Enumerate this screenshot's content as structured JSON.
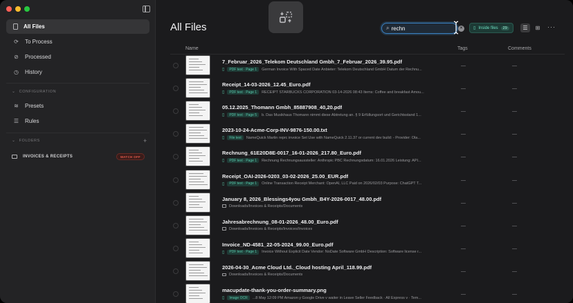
{
  "sidebar": {
    "nav": [
      {
        "label": "All Files",
        "icon": "document-icon",
        "active": true
      },
      {
        "label": "To Process",
        "icon": "refresh-icon"
      },
      {
        "label": "Processed",
        "icon": "check-circle-icon"
      },
      {
        "label": "History",
        "icon": "clock-icon"
      }
    ],
    "configuration_label": "CONFIGURATION",
    "config_items": [
      {
        "label": "Presets",
        "icon": "stack-icon"
      },
      {
        "label": "Rules",
        "icon": "list-icon"
      }
    ],
    "folders_label": "FOLDERS",
    "folder": {
      "name": "INVOICES & RECEIPTS",
      "badge": "WATCH OFF"
    }
  },
  "header": {
    "title": "All Files",
    "search_value": "rechn",
    "inside_files_label": "Inside files",
    "inside_files_count": "29"
  },
  "columns": {
    "name": "Name",
    "tags": "Tags",
    "comments": "Comments"
  },
  "files": [
    {
      "name": "7_Februar_2026_Telekom Deutschland Gmbh_7_Februar_2026_39.95.pdf",
      "badge": "PDF text · Page 1",
      "snippet": "German Invoice With Spaced Date Anbieter: Telekom Deutschland GmbH Datum der Rechnu...",
      "tags": "—",
      "comments": "—"
    },
    {
      "name": "Receipt_14-03-2026_12.45_Euro.pdf",
      "badge": "PDF text · Page 1",
      "snippet": "RECEIPT STARBUCKS CORPORATION 03-14-2026 08:43 Items: Coffee and breakfast Amou...",
      "tags": "—",
      "comments": "—"
    },
    {
      "name": "05.12.2025_Thomann Gmbh_85887908_40,20.pdf",
      "badge": "PDF text · Page 5",
      "snippet": "b. Das Musikhaus Thomann nimmt diese Abtretung an. § 9 Erfüllungsort und Gerichtsstand 1...",
      "tags": "—",
      "comments": "—"
    },
    {
      "name": "2023-10-24-Acme-Corp-INV-9876-150.00.txt",
      "badge": "File text",
      "snippet": "NameQuick Martin reprc invoice Set Use with NameQuick 2.11.37 or current dev build: - Provider: Ola...",
      "tags": "—",
      "comments": "—"
    },
    {
      "name": "Rechnung_61E20D8E-0017_16-01-2026_217.80_Euro.pdf",
      "badge": "PDF text · Page 1",
      "snippet": "Rechnung Rechnungsaussteller: Anthropic PBC Rechnungsdatum: 16.01.2026 Leistung: API...",
      "tags": "—",
      "comments": "—"
    },
    {
      "name": "Receipt_OAI-2026-0203_03-02-2026_25.00_EUR.pdf",
      "badge": "PDF text · Page 1",
      "snippet": "Online Transaction Receipt Merchant: OpenAI, LLC Paid on 2026/02/03 Purpose: ChatGPT T...",
      "tags": "—",
      "comments": "—"
    },
    {
      "name": "January 8, 2026_Blessings4you Gmbh_B4Y-2026-0017_48.00.pdf",
      "path": "Downloads/Invoices & Receipts/Documents",
      "tags": "—",
      "comments": "—"
    },
    {
      "name": "Jahresabrechnung_08-01-2026_48.00_Euro.pdf",
      "path": "Downloads/Invoices & Receipts/Invoices/Invoices",
      "tags": "—",
      "comments": "—"
    },
    {
      "name": "Invoice_ND-4581_22-05-2024_99.00_Euro.pdf",
      "badge": "PDF text · Page 1",
      "snippet": "Invoice Without Explicit Date Vendor: NoDate Software GmbH Description: Software license r...",
      "tags": "—",
      "comments": "—"
    },
    {
      "name": "2026-04-30_Acme Cloud Ltd._Cloud hosting April_118.99.pdf",
      "path": "Downloads/Invoices & Receipts/Documents",
      "tags": "—",
      "comments": "—"
    },
    {
      "name": "macupdate-thank-you-order-summary.png",
      "badge": "Image OCR",
      "snippet": "...8 May 12:09 PM Amazon y Google Drive v waiter in Leave Seller Feedback · All Express v · Tem...",
      "tags": "—",
      "comments": "—"
    }
  ]
}
